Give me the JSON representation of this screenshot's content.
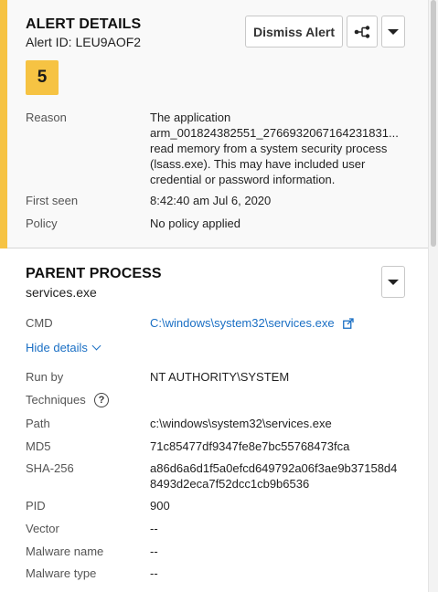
{
  "alert": {
    "title": "ALERT DETAILS",
    "alert_id": "Alert ID: LEU9AOF2",
    "score": "5",
    "dismiss_label": "Dismiss Alert",
    "reason_label": "Reason",
    "reason_line1": "The application",
    "reason_line2": "arm_001824382551_2766932067164231831...",
    "reason_line3": "read memory from a system security process",
    "reason_line4": "(lsass.exe). This may have included user",
    "reason_line5": "credential or password information.",
    "first_seen_label": "First seen",
    "first_seen_value": "8:42:40 am Jul 6, 2020",
    "policy_label": "Policy",
    "policy_value": "No policy applied",
    "severity_color": "#f6c343"
  },
  "parent_process": {
    "title": "PARENT PROCESS",
    "name": "services.exe",
    "cmd_label": "CMD",
    "cmd_value": "C:\\windows\\system32\\services.exe",
    "hide_details_label": "Hide details",
    "run_by_label": "Run by",
    "run_by_value": "NT AUTHORITY\\SYSTEM",
    "techniques_label": "Techniques",
    "path_label": "Path",
    "path_value": "c:\\windows\\system32\\services.exe",
    "md5_label": "MD5",
    "md5_value": "71c85477df9347fe8e7bc55768473fca",
    "sha_label": "SHA-256",
    "sha_line1": "a86d6a6d1f5a0efcd649792a06f3ae9b37158d4",
    "sha_line2": "8493d2eca7f52dcc1cb9b6536",
    "pid_label": "PID",
    "pid_value": "900",
    "vector_label": "Vector",
    "vector_value": "--",
    "malware_name_label": "Malware name",
    "malware_name_value": "--",
    "malware_type_label": "Malware type",
    "malware_type_value": "--"
  },
  "icons": {
    "share": "share-nodes-icon",
    "menu": "caret-down-icon",
    "external": "external-link-icon",
    "help": "question-circle-icon",
    "chevron": "chevron-down-icon"
  }
}
